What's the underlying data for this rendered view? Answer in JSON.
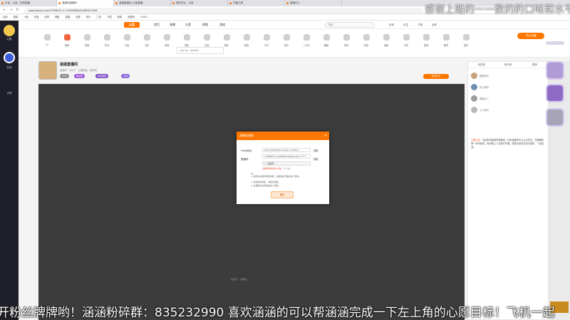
{
  "browser": {
    "tabs": [
      {
        "label": "平台 - 斗鱼 - 在线直播"
      },
      {
        "label": "涵涵的直播间"
      },
      {
        "label": "涵涵直播间_斗鱼直播"
      },
      {
        "label": "我的关注 - 斗鱼"
      },
      {
        "label": "开播工具"
      },
      {
        "label": "直播中心"
      }
    ],
    "url": "www.douyu.com/7748537 y=1329080051585911394",
    "back_icon": "arrow-left-icon",
    "forward_icon": "arrow-right-icon",
    "reload_icon": "reload-icon",
    "bookmarks": [
      "应用",
      "超链",
      "斗鱼",
      "动漫",
      "影视",
      "博客",
      "直播",
      "设置",
      "音乐",
      "工具",
      "下载",
      "帮助",
      "收藏夹",
      "LEVEL"
    ]
  },
  "overlay_left": {
    "labels": [
      "心愿",
      "在线",
      "点赞"
    ]
  },
  "site": {
    "logo": "斗鱼",
    "nav": [
      "首页",
      "直播",
      "分类",
      "视频",
      "游戏"
    ],
    "search_placeholder": "搜索",
    "header_right": [
      "历史",
      "关注",
      "下载",
      "创作"
    ],
    "categories": [
      "12",
      "推荐",
      "英雄",
      "吃鸡",
      "王者",
      "主机",
      "网游",
      "单机",
      "手游",
      "娱乐",
      "颜值",
      "户外",
      "音乐",
      "二次元",
      "舞蹈",
      "体育",
      "科技",
      "美食",
      "汽车",
      "旅游",
      "教育",
      "更多"
    ],
    "category_hint": "直播分类 · 选择游戏",
    "follow_button": "关注主播"
  },
  "streamer": {
    "name": "涵涵直播间",
    "sub": "直播中 · 6637 · 主播等级 · 房间号",
    "badges": [
      "LV30",
      "粉丝团",
      "等级徽章",
      "心愿"
    ],
    "action_button": "开启打卡"
  },
  "player": {
    "loading_text": "加载中，请稍候..."
  },
  "chat": {
    "tabs": [
      "贵宾席",
      "粉丝榜",
      "周榜"
    ],
    "rank_names": [
      "超管用户",
      "热心观众",
      "弹幕达人",
      "小小观众"
    ],
    "notice_lead": "主播公告：",
    "notice_body": "欢迎来到涵涵的直播间，喜欢涵涵的可以点点关注，开播通知第一时间收到，每天晚上八点准时开播，感谢大家的支持与陪伴，一起加油！"
  },
  "modal": {
    "title": "直播码获取",
    "close_label": "×",
    "fields": [
      {
        "label": "rtmp地址：",
        "value": "rtmp://sendtc3a.douyu.com/live",
        "copy": "复制"
      },
      {
        "label": "直播码：",
        "value": "7748537rnucg5Pvfeh?wsSecret=******",
        "copy": "复制"
      }
    ],
    "select_value": "— 请选择 —",
    "red_note": "直播码有效期15分钟",
    "red_note_link": "什么是？",
    "tips_title": "注：",
    "tips": [
      "1. 推流时请保持网络通畅，直播码在开播状态下有效。",
      "2. 如需重新获取，请刷新页面。",
      "3. 直播码请勿泄露给他人使用。"
    ],
    "confirm_button": "确定"
  },
  "overlay_top_text": "感谢上船的一一数的的口味和水平",
  "ticker_text": "开粉丝牌牌哟！涵涵粉碎群：835232990 喜欢涵涵的可以帮涵涵完成一下左上角的心愿目标！飞机一起",
  "colors": {
    "accent": "#ff7700",
    "player_bg": "#3c3c3c",
    "overlay_bg": "#1f1f2b"
  }
}
